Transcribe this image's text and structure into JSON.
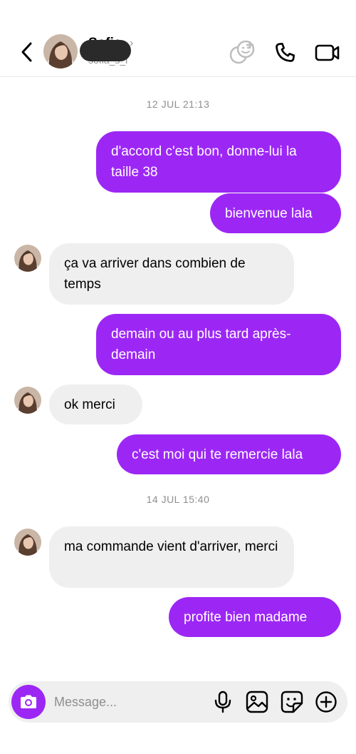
{
  "header": {
    "contact_name": "Sofia",
    "name_chevron": "›",
    "username": "sofia_s_l",
    "icons": {
      "back": "chevron-left-icon",
      "effects": "effects-icon",
      "call": "phone-icon",
      "video": "video-camera-icon"
    }
  },
  "conversation": {
    "timestamps": [
      "12 JUL 21:13",
      "14 JUL 15:40"
    ],
    "messages": [
      {
        "direction": "outgoing",
        "text": "d'accord c'est bon, donne-lui la taille 38"
      },
      {
        "direction": "outgoing",
        "text": "bienvenue lala"
      },
      {
        "direction": "incoming",
        "text": "ça va arriver dans combien de temps"
      },
      {
        "direction": "outgoing",
        "text": "demain ou au plus tard après-demain"
      },
      {
        "direction": "incoming",
        "text": "ok merci"
      },
      {
        "direction": "outgoing",
        "text": "c'est moi qui te remercie lala"
      },
      {
        "direction": "incoming",
        "text": "ma commande vient d'arriver, merci"
      },
      {
        "direction": "outgoing",
        "text": "profite bien madame"
      }
    ]
  },
  "composer": {
    "placeholder": "Message...",
    "icons": [
      "camera-icon",
      "microphone-icon",
      "gallery-icon",
      "sticker-icon",
      "plus-icon"
    ]
  },
  "colors": {
    "outgoing_bubble": "#9c27f5",
    "incoming_bubble": "#efefef",
    "accent": "#9c27f5"
  }
}
